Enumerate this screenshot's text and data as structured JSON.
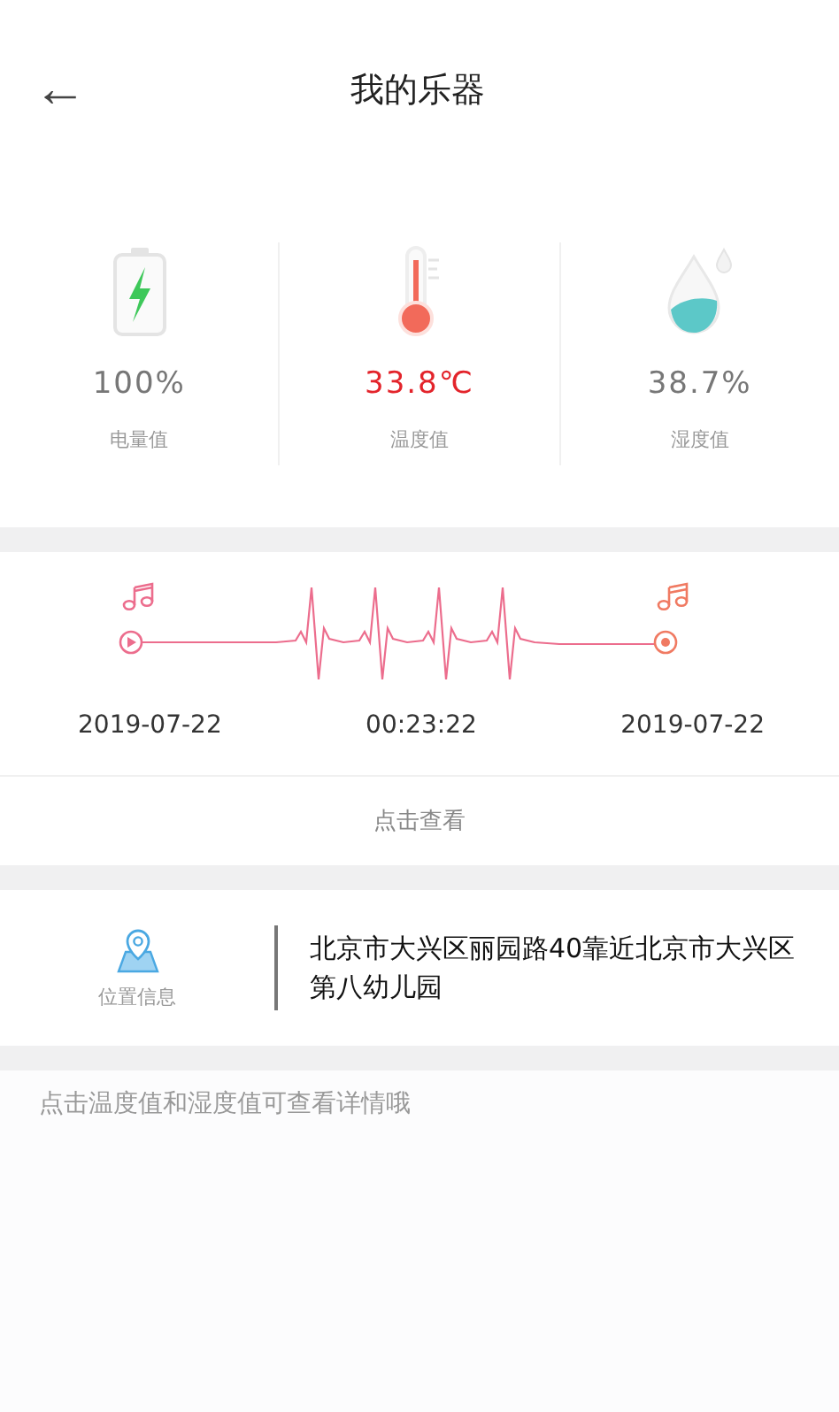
{
  "header": {
    "title": "我的乐器",
    "back": "←"
  },
  "stats": [
    {
      "kind": "battery",
      "value": "100%",
      "label": "电量值"
    },
    {
      "kind": "temperature",
      "value": "33.8℃",
      "label": "温度值"
    },
    {
      "kind": "humidity",
      "value": "38.7%",
      "label": "湿度值"
    }
  ],
  "timeline": {
    "start": "2019-07-22",
    "duration": "00:23:22",
    "end": "2019-07-22",
    "action": "点击查看"
  },
  "location": {
    "label": "位置信息",
    "address": "北京市大兴区丽园路40靠近北京市大兴区第八幼儿园"
  },
  "hint": "点击温度值和湿度值可查看详情哦"
}
